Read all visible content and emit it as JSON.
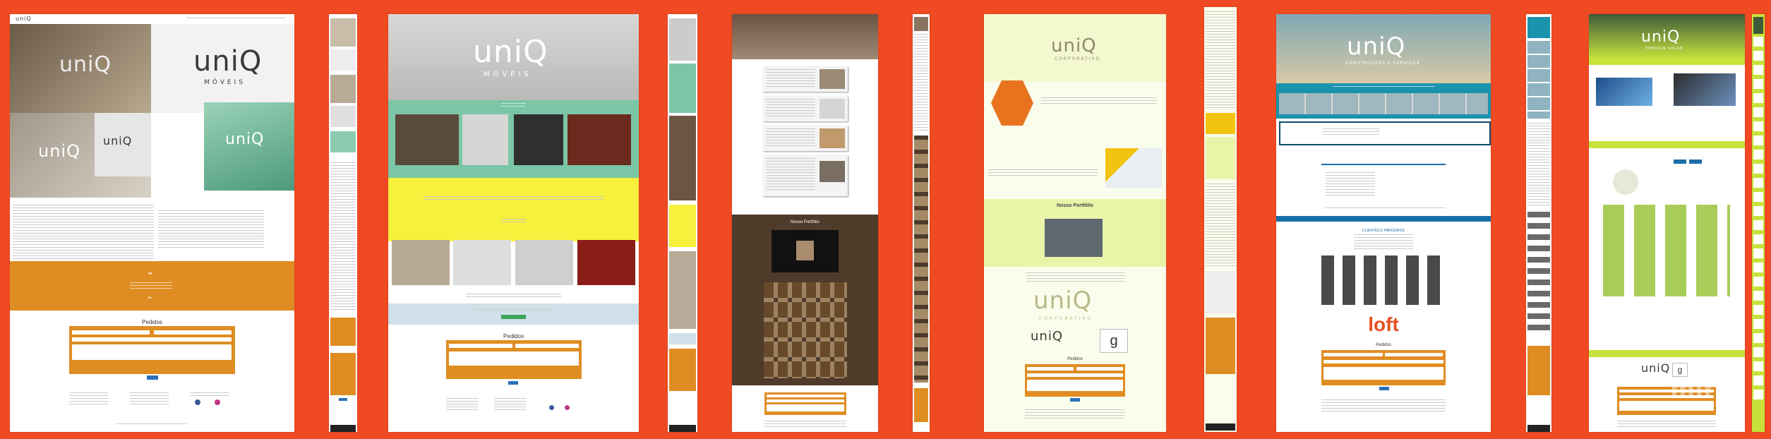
{
  "board": {
    "background": "#f04a22",
    "watermark": "miro"
  },
  "brand": {
    "moveis": "uniQ",
    "moveis_sub": "MÓVEIS",
    "corporativo": "uniQ",
    "corporativo_sub": "CORPORATIVO",
    "construcoes": "uniQ",
    "construcoes_sub": "CONSTRUÇÕES E SERVIÇOS",
    "energia": "uniQ",
    "energia_sub": "ENERGIA SOLAR"
  },
  "sections": {
    "pedidos": "Pedidos",
    "portfolio": "Nosso Portfólio",
    "clientes": "CLIENTES E PARCEIROS",
    "loft": "loft"
  },
  "colors": {
    "orange": "#df8d22",
    "teal": "#7bc6a6",
    "yellow": "#f7f03c",
    "dark_brown": "#4e3b2a",
    "lime": "#c6e23b",
    "cream": "#f4f8cf",
    "blue": "#2d6fb7",
    "hex_orange": "#e8731f"
  }
}
